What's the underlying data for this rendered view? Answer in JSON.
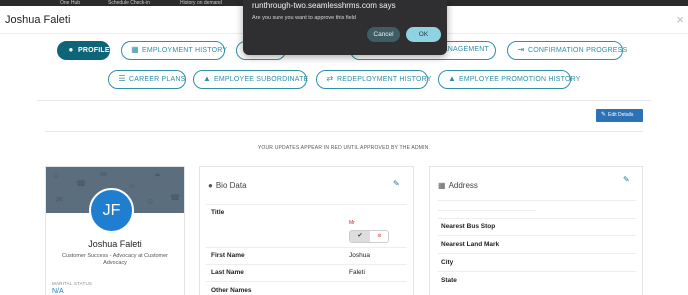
{
  "browser_tabs": [
    "One Hub",
    "Schedule Check-in",
    "History on demand"
  ],
  "header": {
    "employee_name": "Joshua Faleti",
    "close_glyph": "×"
  },
  "tabs_row1": [
    {
      "label": "PROFILE",
      "icon": "user-icon",
      "glyph": "👤",
      "active": true
    },
    {
      "label": "EMPLOYMENT HISTORY",
      "icon": "id-card-icon",
      "glyph": "🪪",
      "active": false
    },
    {
      "label": "",
      "icon": "hidden-tab",
      "glyph": "",
      "active": false
    },
    {
      "label": "MANAGEMENT",
      "icon": "",
      "glyph": "",
      "active": false
    },
    {
      "label": "CONFIRMATION PROGRESS",
      "icon": "sign-in-icon",
      "glyph": "⇥",
      "active": false
    }
  ],
  "tabs_row2": [
    {
      "label": "CAREER PLANS",
      "icon": "list-icon",
      "glyph": "☰"
    },
    {
      "label": "EMPLOYEE SUBORDINATE",
      "icon": "bank-icon",
      "glyph": "🏛"
    },
    {
      "label": "REDEPLOYMENT HISTORY",
      "icon": "exchange-icon",
      "glyph": "⇄"
    },
    {
      "label": "EMPLOYEE PROMOTION HISTORY",
      "icon": "bank-icon",
      "glyph": "🏛"
    }
  ],
  "edit_button": "Edit Details",
  "notice": "YOUR UPDATES APPEAR IN RED UNTIL APPROVED BY THE ADMIN.",
  "profile": {
    "initials": "JF",
    "name": "Joshua Faleti",
    "role": "Customer Success - Advocacy at Customer Advocacy",
    "marital_status_label": "MARITAL STATUS",
    "marital_status": "N/A"
  },
  "bio": {
    "title": "Bio Data",
    "title_label": "Title",
    "title_pending": "Mr",
    "approve_glyph": "✔",
    "reject_glyph": "⊘",
    "rows": [
      {
        "label": "First Name",
        "value": "Joshua"
      },
      {
        "label": "Last Name",
        "value": "Faleti"
      },
      {
        "label": "Other Names",
        "value": ""
      }
    ]
  },
  "address": {
    "title": "Address",
    "rows": [
      "Nearest Bus Stop",
      "Nearest Land Mark",
      "City",
      "State"
    ]
  },
  "dialog": {
    "title": "runthrough-two.seamlesshrms.com says",
    "message": "Are you sure you want to approve this field",
    "cancel": "Cancel",
    "ok": "OK"
  }
}
